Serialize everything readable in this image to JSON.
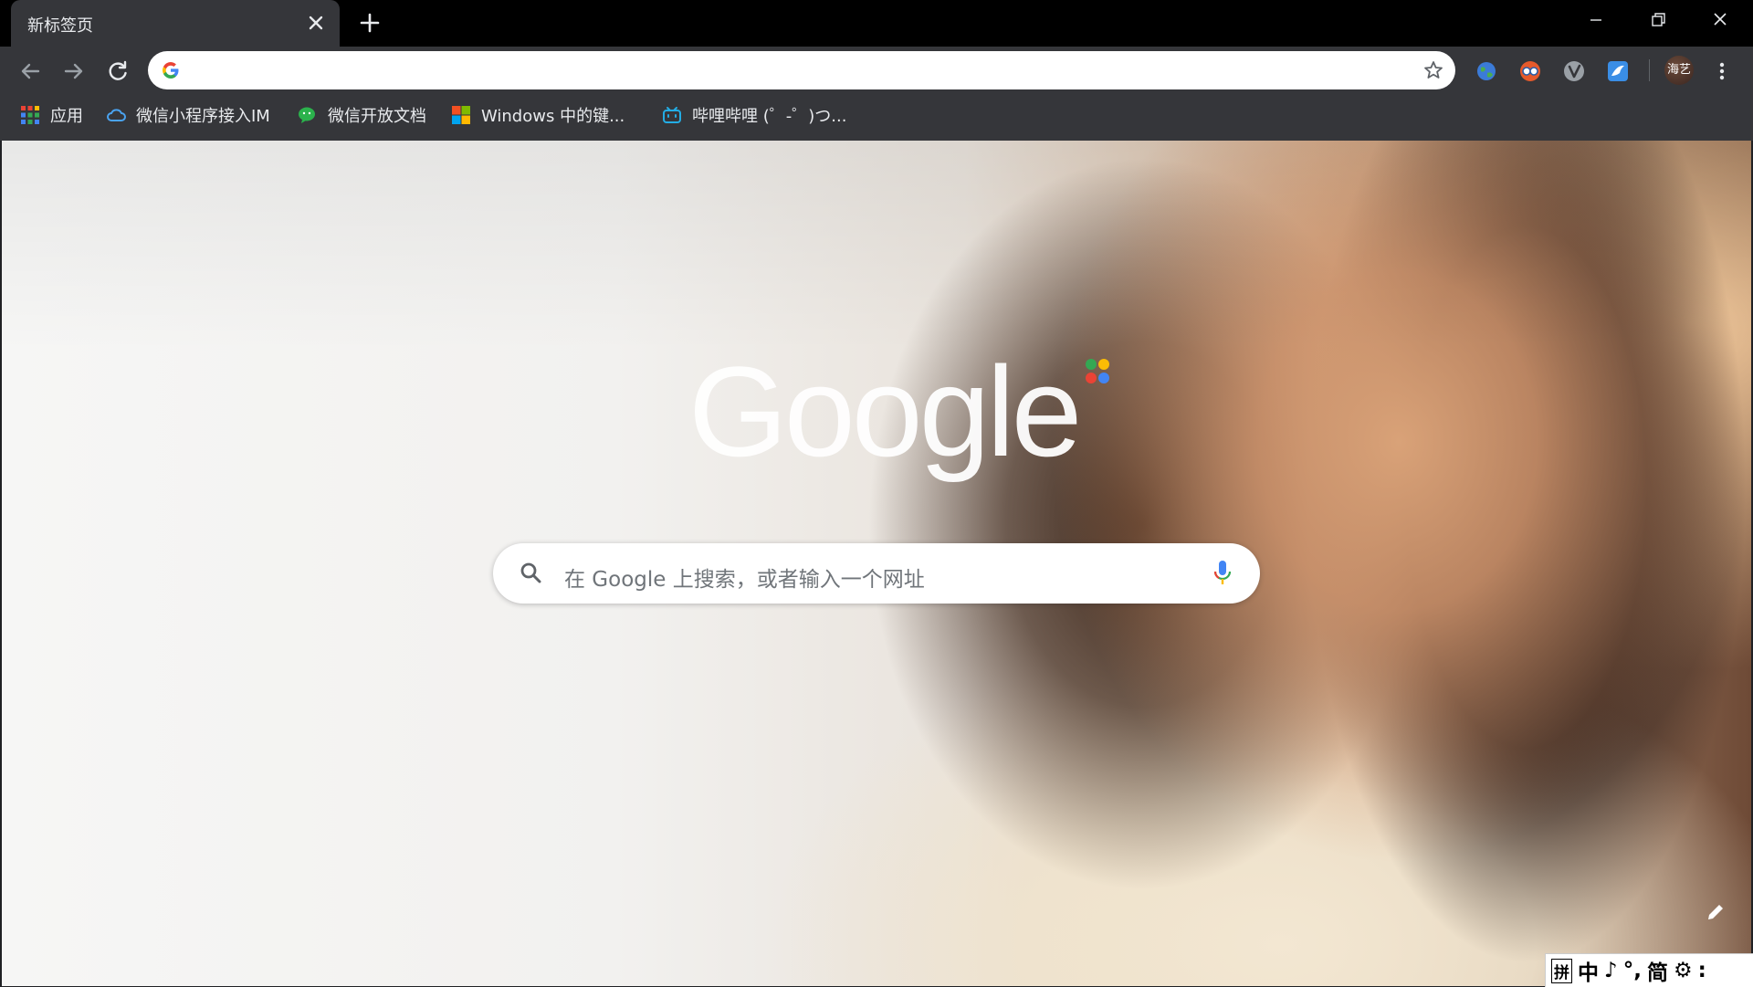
{
  "tab": {
    "title": "新标签页"
  },
  "omnibox": {
    "value": "",
    "placeholder": ""
  },
  "profile": {
    "name": "海艺"
  },
  "bookmarks": [
    {
      "label": "应用",
      "icon": "apps-grid-icon"
    },
    {
      "label": "微信小程序接入IM",
      "icon": "cloud-icon"
    },
    {
      "label": "微信开放文档",
      "icon": "wechat-icon"
    },
    {
      "label": "Windows 中的键...",
      "icon": "windows-icon"
    },
    {
      "label": "哔哩哔哩 (゜-゜)つ...",
      "icon": "bilibili-icon"
    }
  ],
  "extensions": [
    "globe-extension-icon",
    "glasses-extension-icon",
    "v-extension-icon",
    "bird-extension-icon"
  ],
  "ntp": {
    "logo": "Google",
    "search_placeholder": "在 Google 上搜索，或者输入一个网址"
  },
  "ime": {
    "items": [
      "拼",
      "中",
      "♪",
      "°,",
      "简",
      "⚙",
      ":"
    ]
  },
  "colors": {
    "frame": "#000000",
    "toolbar": "#35363a",
    "tab_text": "#e8eaed",
    "google_blue": "#4285f4",
    "google_red": "#ea4335",
    "google_yellow": "#fbbc05",
    "google_green": "#34a853"
  }
}
